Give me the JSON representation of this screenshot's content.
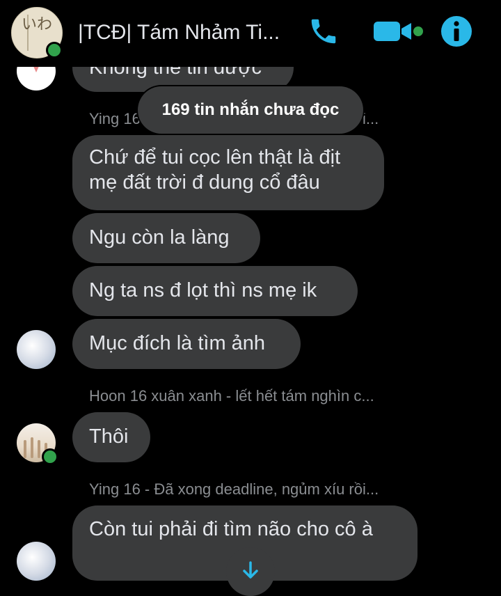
{
  "header": {
    "title": "|TCĐ| Tám Nhảm Ti...",
    "avatar_text": "いわ",
    "call_icon": "phone-icon",
    "video_icon": "video-camera-icon",
    "info_icon": "info-icon",
    "accent_color": "#0a7cff",
    "icon_color": "#2ab8e8"
  },
  "unread_banner": "169 tin nhắn chưa đọc",
  "messages": [
    {
      "text": "Không thể tin được"
    },
    {
      "sender": "Ying 16 - Đã xong deadline, ngủm xíu rồi..."
    },
    {
      "text": "Chứ để tui cọc lên thật là địt mẹ đất trời đ dung cổ đâu"
    },
    {
      "text": "Ngu còn la làng"
    },
    {
      "text": "Ng ta ns đ lọt thì ns mẹ ik"
    },
    {
      "text": "Mục đích là tìm ảnh"
    },
    {
      "sender": "Hoon 16 xuân xanh - lết hết tám nghìn c..."
    },
    {
      "text": "Thôi"
    },
    {
      "sender": "Ying 16 - Đã xong deadline, ngủm xíu rồi..."
    },
    {
      "text": "Còn tui phải đi tìm não cho cô à"
    }
  ],
  "scroll_down_icon": "arrow-down-icon",
  "bubble_color": "#3a3b3c",
  "online_color": "#31a24c"
}
